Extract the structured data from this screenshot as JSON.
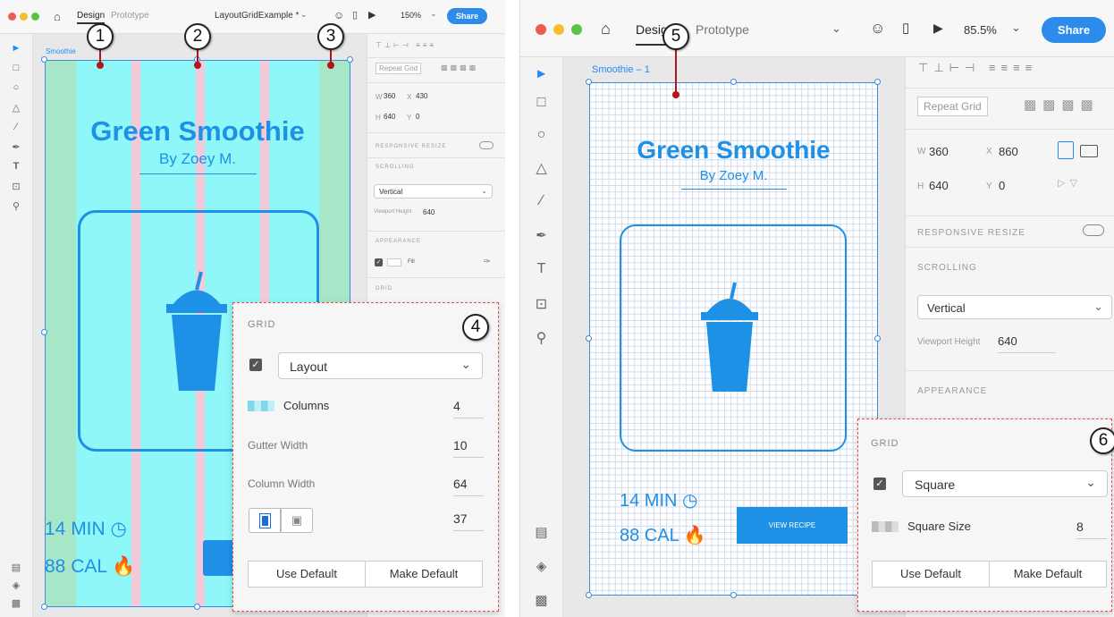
{
  "left": {
    "tabs": [
      "Design",
      "Prototype"
    ],
    "doc_title": "LayoutGridExample *",
    "zoom": "150%",
    "share_label": "Share",
    "artboard_label": "Smoothie",
    "art": {
      "title": "Green Smoothie",
      "byline": "By Zoey M.",
      "time": "14 MIN",
      "calories": "88 CAL"
    },
    "inspector": {
      "repeat_grid": "Repeat Grid",
      "w_label": "W",
      "w_value": "360",
      "x_label": "X",
      "x_value": "430",
      "h_label": "H",
      "h_value": "640",
      "y_label": "Y",
      "y_value": "0",
      "responsive_resize": "RESPONSIVE RESIZE",
      "scrolling": "SCROLLING",
      "scroll_value": "Vertical",
      "viewport_label": "Viewport Height",
      "viewport_value": "640",
      "appearance": "APPEARANCE",
      "fill_label": "Fill",
      "grid_label": "GRID"
    },
    "grid_popup": {
      "title": "GRID",
      "type": "Layout",
      "columns_label": "Columns",
      "columns_value": "4",
      "gutter_label": "Gutter Width",
      "gutter_value": "10",
      "colwidth_label": "Column Width",
      "colwidth_value": "64",
      "margin_value": "37",
      "use_default": "Use Default",
      "make_default": "Make Default"
    },
    "callouts": [
      "1",
      "2",
      "3",
      "4"
    ]
  },
  "right": {
    "tabs": [
      "Design",
      "Prototype"
    ],
    "zoom": "85.5%",
    "share_label": "Share",
    "artboard_label": "Smoothie – 1",
    "art": {
      "title": "Green Smoothie",
      "byline": "By Zoey M.",
      "time": "14 MIN",
      "calories": "88 CAL",
      "button": "VIEW RECIPE"
    },
    "inspector": {
      "repeat_grid": "Repeat Grid",
      "w_label": "W",
      "w_value": "360",
      "x_label": "X",
      "x_value": "860",
      "h_label": "H",
      "h_value": "640",
      "y_label": "Y",
      "y_value": "0",
      "responsive_resize": "RESPONSIVE RESIZE",
      "scrolling": "SCROLLING",
      "scroll_value": "Vertical",
      "viewport_label": "Viewport Height",
      "viewport_value": "640",
      "appearance": "APPEARANCE"
    },
    "grid_popup": {
      "title": "GRID",
      "type": "Square",
      "square_label": "Square Size",
      "square_value": "8",
      "use_default": "Use Default",
      "make_default": "Make Default"
    },
    "callouts": [
      "5",
      "6"
    ]
  },
  "colors": {
    "accent_blue": "#1a8cff",
    "column_cyan": "#8ff7f7",
    "margin_green": "#a8e6c8",
    "gutter_pink": "#f5c9d8",
    "art_blue": "#1e90e6",
    "share_blue": "#2d8ceb",
    "callout_red": "#b3141a"
  }
}
